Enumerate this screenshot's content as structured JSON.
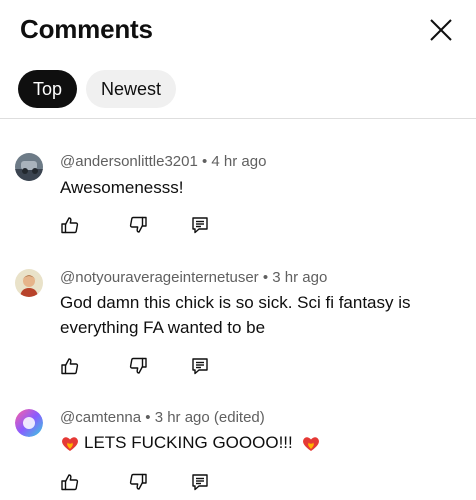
{
  "header": {
    "title": "Comments"
  },
  "tabs": [
    {
      "label": "Top"
    },
    {
      "label": "Newest"
    }
  ],
  "comments": [
    {
      "author": "@andersonlittle3201",
      "time": "4 hr ago",
      "text": "Awesomenesss!"
    },
    {
      "author": "@notyouraverageinternetuser",
      "time": "3 hr ago",
      "text": "God damn this chick is so sick. Sci fi fantasy is everything FA wanted to be"
    },
    {
      "author": "@camtenna",
      "time": "3 hr ago (edited)",
      "text": "LETS FUCKING GOOOO!!!"
    }
  ],
  "icons": {
    "close": "close-icon",
    "like": "thumbs-up-icon",
    "dislike": "thumbs-down-icon",
    "reply": "reply-icon",
    "heart": "heart-on-fire-emoji"
  }
}
